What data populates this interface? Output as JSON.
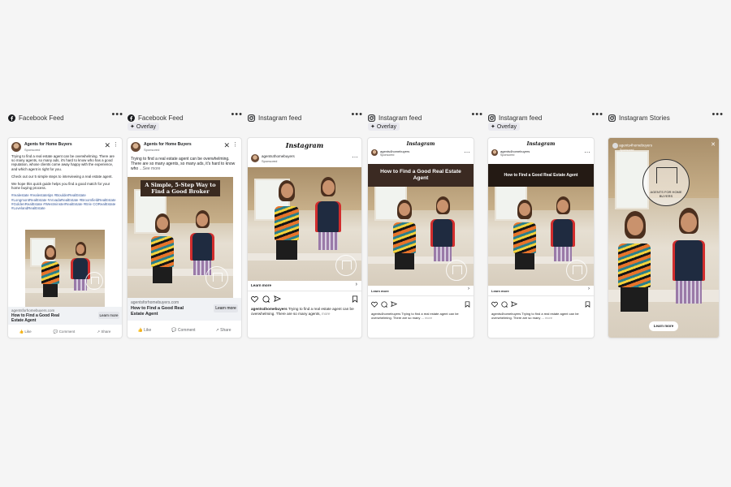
{
  "columns": [
    {
      "label": "Facebook Feed",
      "overlay": null
    },
    {
      "label": "Facebook Feed",
      "overlay": "Overlay"
    },
    {
      "label": "Instagram feed",
      "overlay": null
    },
    {
      "label": "Instagram feed",
      "overlay": "Overlay"
    },
    {
      "label": "Instagram feed",
      "overlay": "Overlay"
    },
    {
      "label": "Instagram Stories",
      "overlay": null
    }
  ],
  "more_glyph": "•••",
  "page_name": "Agents for Home Buyers",
  "sponsored": "Sponsored",
  "fb1": {
    "body": "Trying to find a real estate agent can be overwhelming. There are so many agents, so many ads, it's hard to know who has a good reputation, whose clients come away happy with the experience, and which agent is right for you.",
    "body2": "Check out our 5 simple steps to interviewing a real estate agent.",
    "body3": "We hope this quick guide helps you find a good match for your home buying process.",
    "tags": "#realestate #realestatetips #BoulderRealEstate #LongmontRealEstate #ArvadaRealEstate #BroomfieldRealEstate #GoldenRealEstate #WestminsterRealEstate #Erie CORealEstate #LovelandRealEstate",
    "domain": "agentsforhomebuyers.com",
    "link_title": "How to Find a Good Real Estate Agent",
    "learn_more": "Learn more",
    "like": "Like",
    "comment": "Comment",
    "share": "Share"
  },
  "fb2": {
    "body": "Trying to find a real estate agent can be overwhelming. There are so many agents, so many ads, it's hard to know who",
    "see_more": "...See more",
    "overlay_title": "A Simple, 5-Step Way to Find a Good Broker",
    "domain": "agentsforhomebuyers.com",
    "link_title": "How to Find a Good Real Estate Agent",
    "learn_more": "Learn more",
    "like": "Like",
    "comment": "Comment",
    "share": "Share"
  },
  "ig": {
    "logo": "Instagram",
    "handle": "agents4homebuyers",
    "sponsored": "Sponsored",
    "learn_more": "Learn more",
    "caption_user": "agents4homebuyers",
    "caption": "Trying to find a real estate agent can be overwhelming. There are so many agents,",
    "caption_short": "Trying to find a real estate agent can be overwhelming. There are so many ...",
    "more": "more",
    "banner1": "How to Find a Good Real Estate Agent",
    "banner2": "How to Find a Good Real Estate Agent"
  },
  "story": {
    "handle": "agents4homebuyers",
    "sponsored": "Sponsored",
    "logo_text": "AGENTS FOR HOME BUYERS",
    "learn_more": "Learn more"
  },
  "colors": {
    "background": "#f5f5f5",
    "overlay_brown": "#3a2a20",
    "fb_blue": "#1877f2"
  }
}
